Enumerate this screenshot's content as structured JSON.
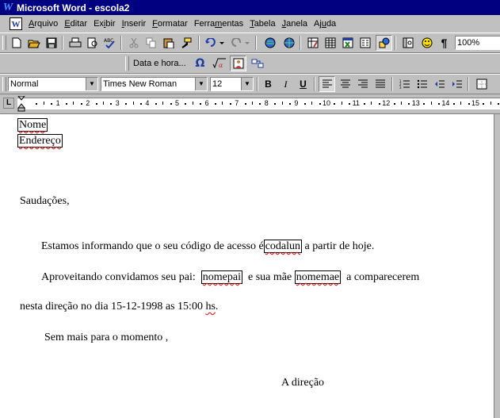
{
  "window": {
    "title": "Microsoft Word - escola2"
  },
  "menu": [
    {
      "pre": "",
      "u": "A",
      "post": "rquivo"
    },
    {
      "pre": "",
      "u": "E",
      "post": "ditar"
    },
    {
      "pre": "Ex",
      "u": "i",
      "post": "bir"
    },
    {
      "pre": "",
      "u": "I",
      "post": "nserir"
    },
    {
      "pre": "",
      "u": "F",
      "post": "ormatar"
    },
    {
      "pre": "Ferra",
      "u": "m",
      "post": "entas"
    },
    {
      "pre": "",
      "u": "T",
      "post": "abela"
    },
    {
      "pre": "",
      "u": "J",
      "post": "anela"
    },
    {
      "pre": "Aj",
      "u": "u",
      "post": "da"
    }
  ],
  "toolbar_standard": {
    "zoom": "100%"
  },
  "toolbar_insert": {
    "date_time_label": "Data e hora...",
    "omega": "Ω"
  },
  "toolbar_format": {
    "style": "Normal",
    "font": "Times New Roman",
    "size": "12",
    "bold": "B",
    "italic": "I",
    "underline": "U"
  },
  "ruler": {
    "numbers": [
      "1",
      "2",
      "3",
      "4",
      "5",
      "6",
      "7",
      "8",
      "9",
      "10",
      "11",
      "12",
      "13",
      "14",
      "15"
    ]
  },
  "document": {
    "field_nome": "Nome",
    "field_endereco": "Endereço",
    "saudacoes": "Saudações,",
    "p1_before": "Estamos informando que o seu código de acesso é",
    "field_codalun": "codalun",
    "p1_after": "a partir de hoje.",
    "p2_before": "Aproveitando convidamos seu pai:",
    "field_nomepai": "nomepai",
    "p2_mid": "e sua mãe",
    "field_nomemae": "nomemae",
    "p2_after": "a comparecerem",
    "p3_before": "nesta direção no dia 15-12-1998 as 15:00",
    "p3_hs": "hs",
    "p3_dot": ".",
    "closing": "Sem mais para o momento ,",
    "signature": "A direção"
  }
}
